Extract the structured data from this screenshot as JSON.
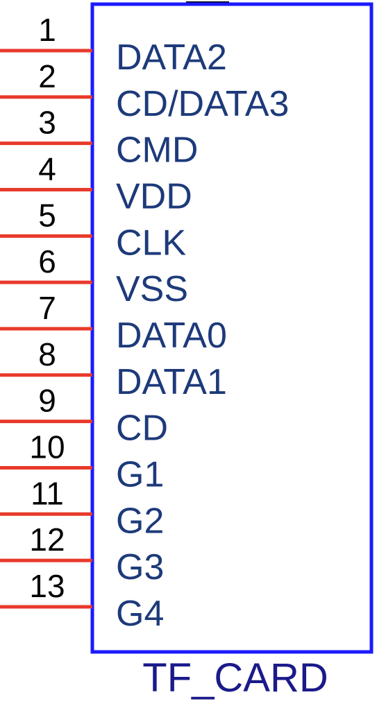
{
  "component": {
    "name": "TF_CARD",
    "body_color": "#1a1aff",
    "pin_color": "#e8392b",
    "pin_name_color": "#1d3a7a",
    "pin_number_color": "#000000",
    "name_color": "#1a1a8a"
  },
  "pins": [
    {
      "number": "1",
      "name": "DATA2"
    },
    {
      "number": "2",
      "name": "CD/DATA3"
    },
    {
      "number": "3",
      "name": "CMD"
    },
    {
      "number": "4",
      "name": "VDD"
    },
    {
      "number": "5",
      "name": "CLK"
    },
    {
      "number": "6",
      "name": "VSS"
    },
    {
      "number": "7",
      "name": "DATA0"
    },
    {
      "number": "8",
      "name": "DATA1"
    },
    {
      "number": "9",
      "name": "CD"
    },
    {
      "number": "10",
      "name": "G1"
    },
    {
      "number": "11",
      "name": "G2"
    },
    {
      "number": "12",
      "name": "G3"
    },
    {
      "number": "13",
      "name": "G4"
    }
  ]
}
